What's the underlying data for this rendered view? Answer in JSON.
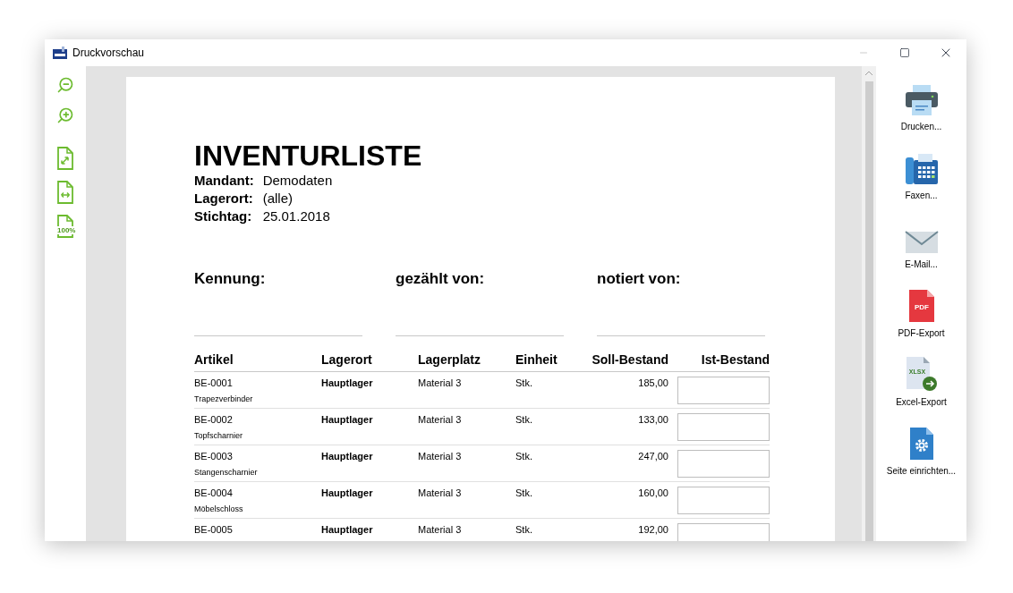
{
  "window": {
    "title": "Druckvorschau",
    "controls": [
      {
        "kind": "minimize",
        "disabled": true
      },
      {
        "kind": "maximize",
        "disabled": false
      },
      {
        "kind": "close",
        "disabled": false
      }
    ]
  },
  "left_toolbar": [
    {
      "kind": "zoom-out"
    },
    {
      "kind": "zoom-in"
    },
    {
      "kind": "fit-page"
    },
    {
      "kind": "fit-width"
    },
    {
      "kind": "actual-size",
      "label": "100%"
    }
  ],
  "document": {
    "title": "INVENTURLISTE",
    "meta": [
      {
        "label": "Mandant:",
        "value": "Demodaten"
      },
      {
        "label": "Lagerort:",
        "value": "(alle)"
      },
      {
        "label": "Stichtag:",
        "value": "25.01.2018"
      }
    ],
    "signatures": [
      "Kennung:",
      "gezählt von:",
      "notiert von:"
    ],
    "table": {
      "columns": [
        "Artikel",
        "Lagerort",
        "Lagerplatz",
        "Einheit",
        "Soll-Bestand",
        "Ist-Bestand"
      ],
      "rows": [
        {
          "article": "BE-0001",
          "description": "Trapezverbinder",
          "location": "Hauptlager",
          "place": "Material 3",
          "unit": "Stk.",
          "target": "185,00"
        },
        {
          "article": "BE-0002",
          "description": "Topfscharnier",
          "location": "Hauptlager",
          "place": "Material 3",
          "unit": "Stk.",
          "target": "133,00"
        },
        {
          "article": "BE-0003",
          "description": "Stangenscharnier",
          "location": "Hauptlager",
          "place": "Material 3",
          "unit": "Stk.",
          "target": "247,00"
        },
        {
          "article": "BE-0004",
          "description": "Möbelschloss",
          "location": "Hauptlager",
          "place": "Material 3",
          "unit": "Stk.",
          "target": "160,00"
        },
        {
          "article": "BE-0005",
          "location": "Hauptlager",
          "place": "Material 3",
          "unit": "Stk.",
          "target": "192,00"
        }
      ]
    }
  },
  "actions": [
    {
      "kind": "print",
      "label": "Drucken..."
    },
    {
      "kind": "fax",
      "label": "Faxen..."
    },
    {
      "kind": "email",
      "label": "E-Mail..."
    },
    {
      "kind": "pdf",
      "label": "PDF-Export",
      "icon_text": "PDF"
    },
    {
      "kind": "excel",
      "label": "Excel-Export",
      "icon_text": "XLSX"
    },
    {
      "kind": "page-setup",
      "label": "Seite einrichten..."
    }
  ]
}
